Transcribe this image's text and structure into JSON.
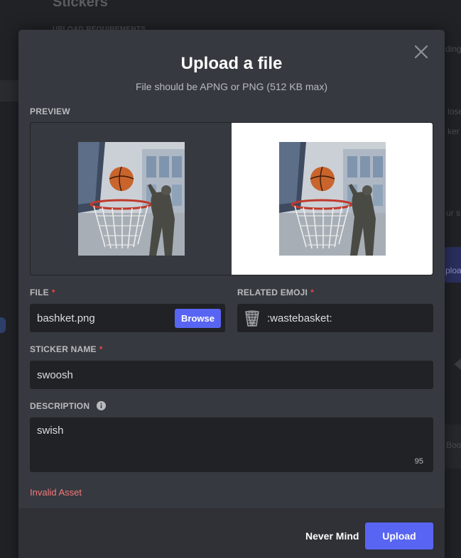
{
  "background": {
    "title": "Stickers",
    "subtitle": "UPLOAD REQUIREMENTS",
    "fragments": [
      "ding",
      "lose",
      "ker",
      "ur s",
      "ploa",
      "Boo"
    ]
  },
  "modal": {
    "title": "Upload a file",
    "subtitle": "File should be APNG or PNG (512 KB max)",
    "preview_label": "PREVIEW",
    "file": {
      "label": "FILE",
      "required_mark": "*",
      "value": "bashket.png",
      "browse_label": "Browse"
    },
    "related_emoji": {
      "label": "RELATED EMOJI",
      "required_mark": "*",
      "icon": "wastebasket-emoji-icon",
      "value": ":wastebasket:"
    },
    "sticker_name": {
      "label": "STICKER NAME",
      "required_mark": "*",
      "value": "swoosh"
    },
    "description": {
      "label": "DESCRIPTION",
      "info_icon": "info-icon",
      "value": "swish",
      "char_count": "95"
    },
    "error": "Invalid Asset",
    "footer": {
      "cancel_label": "Never Mind",
      "upload_label": "Upload"
    }
  },
  "colors": {
    "accent": "#5865f2",
    "error": "#f47a7c",
    "required": "#ed4245",
    "modal_bg": "#36393f",
    "input_bg": "#202225"
  }
}
